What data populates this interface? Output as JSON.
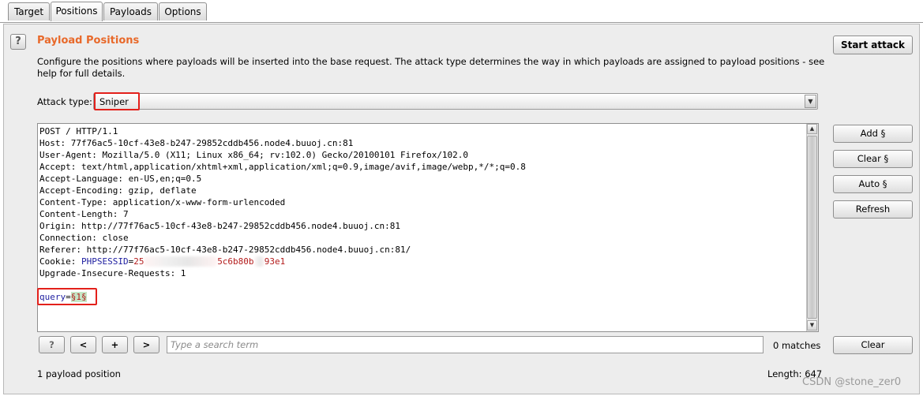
{
  "tabs": [
    {
      "label": "Target"
    },
    {
      "label": "Positions",
      "active": true
    },
    {
      "label": "Payloads"
    },
    {
      "label": "Options"
    }
  ],
  "panel": {
    "help_icon": "?",
    "title": "Payload Positions",
    "description": "Configure the positions where payloads will be inserted into the base request. The attack type determines the way in which payloads are assigned to payload positions - see help for full details."
  },
  "start_attack": "Start attack",
  "attack_type": {
    "label": "Attack type:",
    "value": "Sniper"
  },
  "side_buttons": {
    "add": "Add §",
    "clear": "Clear §",
    "auto": "Auto §",
    "refresh": "Refresh"
  },
  "request": {
    "lines": [
      "POST / HTTP/1.1",
      "Host: 77f76ac5-10cf-43e8-b247-29852cddb456.node4.buuoj.cn:81",
      "User-Agent: Mozilla/5.0 (X11; Linux x86_64; rv:102.0) Gecko/20100101 Firefox/102.0",
      "Accept: text/html,application/xhtml+xml,application/xml;q=0.9,image/avif,image/webp,*/*;q=0.8",
      "Accept-Language: en-US,en;q=0.5",
      "Accept-Encoding: gzip, deflate",
      "Content-Type: application/x-www-form-urlencoded",
      "Content-Length: 7",
      "Origin: http://77f76ac5-10cf-43e8-b247-29852cddb456.node4.buuoj.cn:81",
      "Connection: close",
      "Referer: http://77f76ac5-10cf-43e8-b247-29852cddb456.node4.buuoj.cn:81/"
    ],
    "cookie_prefix": "Cookie: ",
    "cookie_name": "PHPSESSID",
    "cookie_eq": "=",
    "cookie_value_start": "25",
    "cookie_value_end": "5c6b80b",
    "cookie_value_tail": "93e1",
    "upgrade_line": "Upgrade-Insecure-Requests: 1",
    "body_param": "query",
    "body_eq": "=",
    "body_payload": "§1§"
  },
  "search_bar": {
    "help": "?",
    "prev": "<",
    "add": "+",
    "next": ">",
    "placeholder": "Type a search term",
    "matches": "0 matches",
    "clear": "Clear"
  },
  "status": {
    "positions": "1 payload position",
    "length": "Length: 647"
  },
  "watermark": "CSDN @stone_zer0"
}
